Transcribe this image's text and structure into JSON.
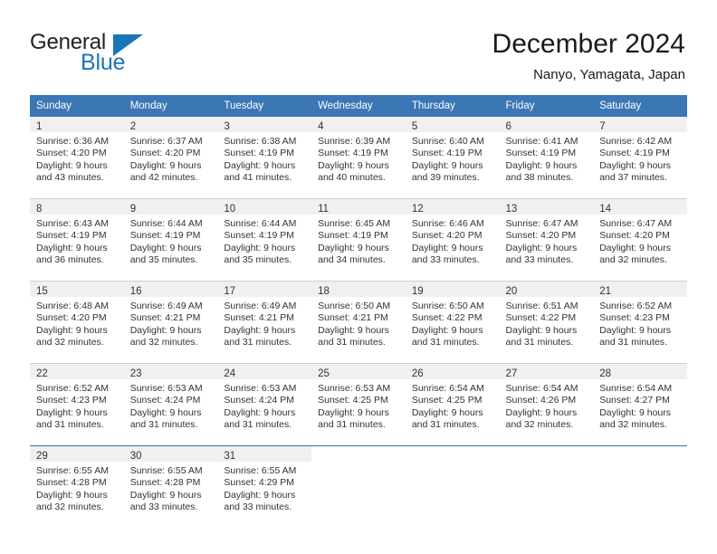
{
  "logo": {
    "text_primary": "General",
    "text_secondary": "Blue",
    "primary_color": "#231f20",
    "secondary_color": "#1b75bb",
    "triangle_icon": "triangle-right-icon"
  },
  "header": {
    "title": "December 2024",
    "subtitle": "Nanyo, Yamagata, Japan"
  },
  "theme": {
    "header_blue": "#3b76b5",
    "daynum_band": "#f0f0f0",
    "separator": "#cfcfcf",
    "text": "#333333"
  },
  "calendar": {
    "weekday_headers": [
      "Sunday",
      "Monday",
      "Tuesday",
      "Wednesday",
      "Thursday",
      "Friday",
      "Saturday"
    ],
    "weeks": [
      [
        {
          "day": "1",
          "sunrise": "Sunrise: 6:36 AM",
          "sunset": "Sunset: 4:20 PM",
          "daylight_line1": "Daylight: 9 hours",
          "daylight_line2": "and 43 minutes."
        },
        {
          "day": "2",
          "sunrise": "Sunrise: 6:37 AM",
          "sunset": "Sunset: 4:20 PM",
          "daylight_line1": "Daylight: 9 hours",
          "daylight_line2": "and 42 minutes."
        },
        {
          "day": "3",
          "sunrise": "Sunrise: 6:38 AM",
          "sunset": "Sunset: 4:19 PM",
          "daylight_line1": "Daylight: 9 hours",
          "daylight_line2": "and 41 minutes."
        },
        {
          "day": "4",
          "sunrise": "Sunrise: 6:39 AM",
          "sunset": "Sunset: 4:19 PM",
          "daylight_line1": "Daylight: 9 hours",
          "daylight_line2": "and 40 minutes."
        },
        {
          "day": "5",
          "sunrise": "Sunrise: 6:40 AM",
          "sunset": "Sunset: 4:19 PM",
          "daylight_line1": "Daylight: 9 hours",
          "daylight_line2": "and 39 minutes."
        },
        {
          "day": "6",
          "sunrise": "Sunrise: 6:41 AM",
          "sunset": "Sunset: 4:19 PM",
          "daylight_line1": "Daylight: 9 hours",
          "daylight_line2": "and 38 minutes."
        },
        {
          "day": "7",
          "sunrise": "Sunrise: 6:42 AM",
          "sunset": "Sunset: 4:19 PM",
          "daylight_line1": "Daylight: 9 hours",
          "daylight_line2": "and 37 minutes."
        }
      ],
      [
        {
          "day": "8",
          "sunrise": "Sunrise: 6:43 AM",
          "sunset": "Sunset: 4:19 PM",
          "daylight_line1": "Daylight: 9 hours",
          "daylight_line2": "and 36 minutes."
        },
        {
          "day": "9",
          "sunrise": "Sunrise: 6:44 AM",
          "sunset": "Sunset: 4:19 PM",
          "daylight_line1": "Daylight: 9 hours",
          "daylight_line2": "and 35 minutes."
        },
        {
          "day": "10",
          "sunrise": "Sunrise: 6:44 AM",
          "sunset": "Sunset: 4:19 PM",
          "daylight_line1": "Daylight: 9 hours",
          "daylight_line2": "and 35 minutes."
        },
        {
          "day": "11",
          "sunrise": "Sunrise: 6:45 AM",
          "sunset": "Sunset: 4:19 PM",
          "daylight_line1": "Daylight: 9 hours",
          "daylight_line2": "and 34 minutes."
        },
        {
          "day": "12",
          "sunrise": "Sunrise: 6:46 AM",
          "sunset": "Sunset: 4:20 PM",
          "daylight_line1": "Daylight: 9 hours",
          "daylight_line2": "and 33 minutes."
        },
        {
          "day": "13",
          "sunrise": "Sunrise: 6:47 AM",
          "sunset": "Sunset: 4:20 PM",
          "daylight_line1": "Daylight: 9 hours",
          "daylight_line2": "and 33 minutes."
        },
        {
          "day": "14",
          "sunrise": "Sunrise: 6:47 AM",
          "sunset": "Sunset: 4:20 PM",
          "daylight_line1": "Daylight: 9 hours",
          "daylight_line2": "and 32 minutes."
        }
      ],
      [
        {
          "day": "15",
          "sunrise": "Sunrise: 6:48 AM",
          "sunset": "Sunset: 4:20 PM",
          "daylight_line1": "Daylight: 9 hours",
          "daylight_line2": "and 32 minutes."
        },
        {
          "day": "16",
          "sunrise": "Sunrise: 6:49 AM",
          "sunset": "Sunset: 4:21 PM",
          "daylight_line1": "Daylight: 9 hours",
          "daylight_line2": "and 32 minutes."
        },
        {
          "day": "17",
          "sunrise": "Sunrise: 6:49 AM",
          "sunset": "Sunset: 4:21 PM",
          "daylight_line1": "Daylight: 9 hours",
          "daylight_line2": "and 31 minutes."
        },
        {
          "day": "18",
          "sunrise": "Sunrise: 6:50 AM",
          "sunset": "Sunset: 4:21 PM",
          "daylight_line1": "Daylight: 9 hours",
          "daylight_line2": "and 31 minutes."
        },
        {
          "day": "19",
          "sunrise": "Sunrise: 6:50 AM",
          "sunset": "Sunset: 4:22 PM",
          "daylight_line1": "Daylight: 9 hours",
          "daylight_line2": "and 31 minutes."
        },
        {
          "day": "20",
          "sunrise": "Sunrise: 6:51 AM",
          "sunset": "Sunset: 4:22 PM",
          "daylight_line1": "Daylight: 9 hours",
          "daylight_line2": "and 31 minutes."
        },
        {
          "day": "21",
          "sunrise": "Sunrise: 6:52 AM",
          "sunset": "Sunset: 4:23 PM",
          "daylight_line1": "Daylight: 9 hours",
          "daylight_line2": "and 31 minutes."
        }
      ],
      [
        {
          "day": "22",
          "sunrise": "Sunrise: 6:52 AM",
          "sunset": "Sunset: 4:23 PM",
          "daylight_line1": "Daylight: 9 hours",
          "daylight_line2": "and 31 minutes."
        },
        {
          "day": "23",
          "sunrise": "Sunrise: 6:53 AM",
          "sunset": "Sunset: 4:24 PM",
          "daylight_line1": "Daylight: 9 hours",
          "daylight_line2": "and 31 minutes."
        },
        {
          "day": "24",
          "sunrise": "Sunrise: 6:53 AM",
          "sunset": "Sunset: 4:24 PM",
          "daylight_line1": "Daylight: 9 hours",
          "daylight_line2": "and 31 minutes."
        },
        {
          "day": "25",
          "sunrise": "Sunrise: 6:53 AM",
          "sunset": "Sunset: 4:25 PM",
          "daylight_line1": "Daylight: 9 hours",
          "daylight_line2": "and 31 minutes."
        },
        {
          "day": "26",
          "sunrise": "Sunrise: 6:54 AM",
          "sunset": "Sunset: 4:25 PM",
          "daylight_line1": "Daylight: 9 hours",
          "daylight_line2": "and 31 minutes."
        },
        {
          "day": "27",
          "sunrise": "Sunrise: 6:54 AM",
          "sunset": "Sunset: 4:26 PM",
          "daylight_line1": "Daylight: 9 hours",
          "daylight_line2": "and 32 minutes."
        },
        {
          "day": "28",
          "sunrise": "Sunrise: 6:54 AM",
          "sunset": "Sunset: 4:27 PM",
          "daylight_line1": "Daylight: 9 hours",
          "daylight_line2": "and 32 minutes."
        }
      ],
      [
        {
          "day": "29",
          "sunrise": "Sunrise: 6:55 AM",
          "sunset": "Sunset: 4:28 PM",
          "daylight_line1": "Daylight: 9 hours",
          "daylight_line2": "and 32 minutes."
        },
        {
          "day": "30",
          "sunrise": "Sunrise: 6:55 AM",
          "sunset": "Sunset: 4:28 PM",
          "daylight_line1": "Daylight: 9 hours",
          "daylight_line2": "and 33 minutes."
        },
        {
          "day": "31",
          "sunrise": "Sunrise: 6:55 AM",
          "sunset": "Sunset: 4:29 PM",
          "daylight_line1": "Daylight: 9 hours",
          "daylight_line2": "and 33 minutes."
        },
        {
          "day": "",
          "sunrise": "",
          "sunset": "",
          "daylight_line1": "",
          "daylight_line2": ""
        },
        {
          "day": "",
          "sunrise": "",
          "sunset": "",
          "daylight_line1": "",
          "daylight_line2": ""
        },
        {
          "day": "",
          "sunrise": "",
          "sunset": "",
          "daylight_line1": "",
          "daylight_line2": ""
        },
        {
          "day": "",
          "sunrise": "",
          "sunset": "",
          "daylight_line1": "",
          "daylight_line2": ""
        }
      ]
    ]
  }
}
